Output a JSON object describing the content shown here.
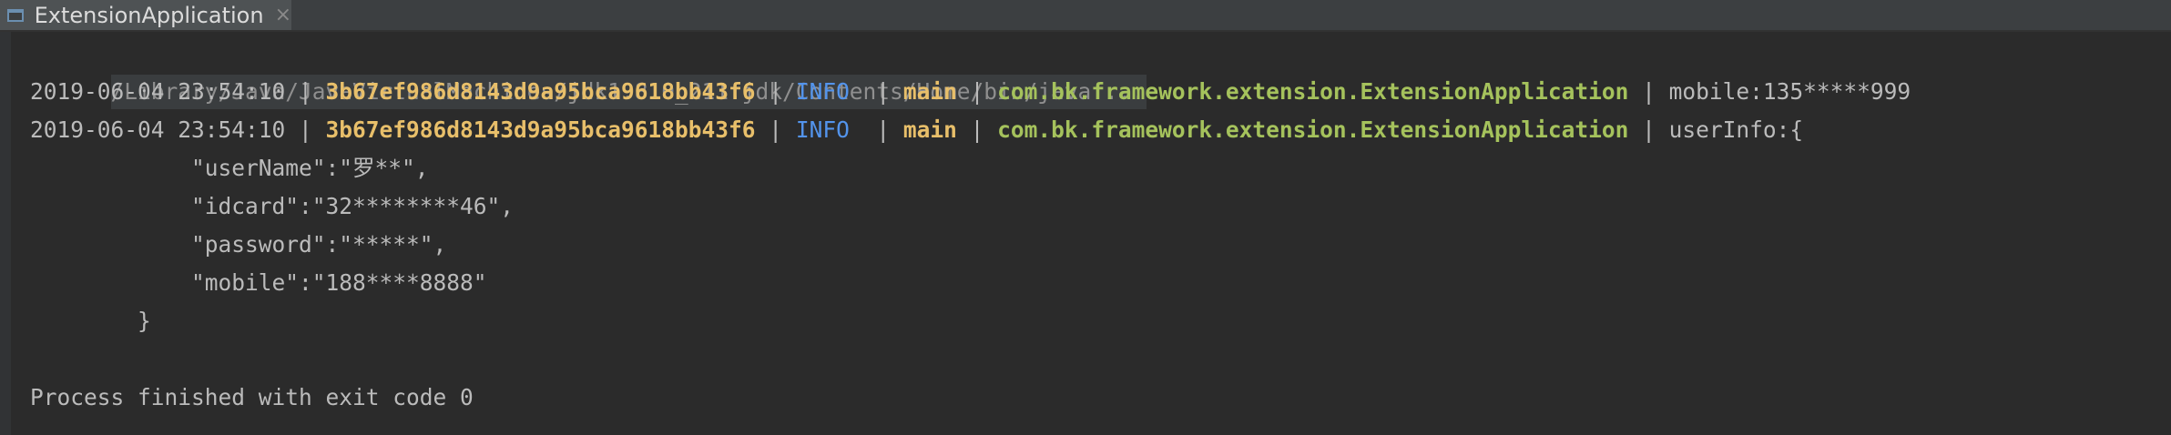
{
  "tab": {
    "title": "ExtensionApplication",
    "close_glyph": "×"
  },
  "console": {
    "command": "/Library/Java/JavaVirtualMachines/jdk1.8.0_211.jdk/Contents/Home/bin/java ...",
    "log_lines": [
      {
        "timestamp": "2019-06-04 23:54:10",
        "trace_id": "3b67ef986d8143d9a95bca9618bb43f6",
        "level": "INFO",
        "thread": "main",
        "logger": "com.bk.framework.extension.ExtensionApplication",
        "message": "mobile:135*****999"
      },
      {
        "timestamp": "2019-06-04 23:54:10",
        "trace_id": "3b67ef986d8143d9a95bca9618bb43f6",
        "level": "INFO",
        "thread": "main",
        "logger": "com.bk.framework.extension.ExtensionApplication",
        "message": "userInfo:{"
      }
    ],
    "json_lines": [
      "            \"userName\":\"罗**\",",
      "            \"idcard\":\"32********46\",",
      "            \"password\":\"*****\",",
      "            \"mobile\":\"188****8888\"",
      "        }"
    ],
    "exit_message": "Process finished with exit code 0"
  },
  "colors": {
    "background": "#2b2b2b",
    "trace_id": "#e8bf6a",
    "level": "#5394ec",
    "logger": "#a5c25c",
    "text": "#bbbbbb"
  }
}
